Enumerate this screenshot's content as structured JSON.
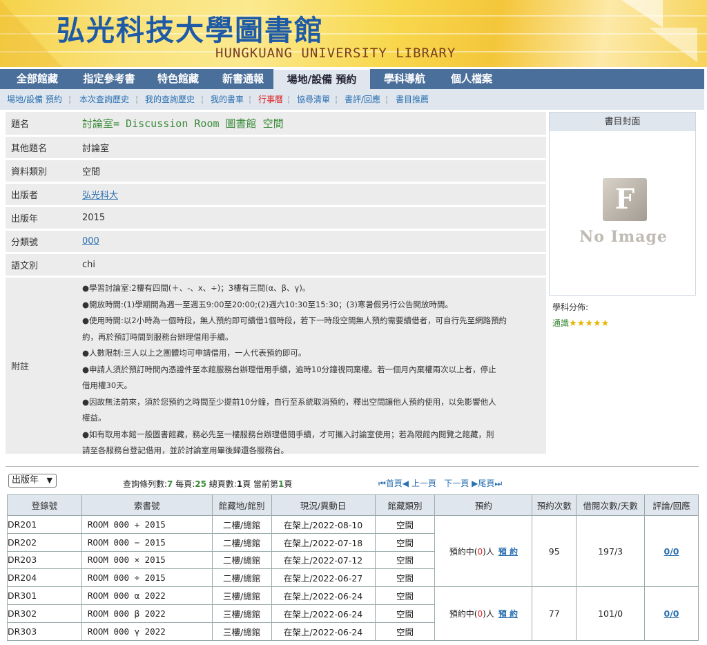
{
  "banner": {
    "title": "弘光科技大學圖書館",
    "subtitle": "HUNGKUANG UNIVERSITY LIBRARY"
  },
  "main_nav": {
    "tabs": [
      "全部館藏",
      "指定參考書",
      "特色館藏",
      "新書通報",
      "場地/設備 預約",
      "學科導航",
      "個人檔案"
    ],
    "active": "場地/設備 預約"
  },
  "sub_nav": {
    "items": [
      "場地/設備 預約",
      "本次查詢歷史",
      "我的查詢歷史",
      "我的書車",
      "行事曆",
      "協尋清單",
      "書評/回應",
      "書目推薦"
    ]
  },
  "record": {
    "title_label": "題名",
    "title_value": "討論室= Discussion Room 圖書館 空間",
    "other_title_label": "其他題名",
    "other_title_value": "討論室",
    "type_label": "資料類別",
    "type_value": "空間",
    "publisher_label": "出版者",
    "publisher_value": "弘光科大",
    "year_label": "出版年",
    "year_value": "2015",
    "class_label": "分類號",
    "class_value": "000",
    "lang_label": "語文別",
    "lang_value": "chi",
    "notes_label": "附註",
    "notes_lines": [
      "●學習討論室:2樓有四間(＋、-、x、÷)；3樓有三間(α、β、γ)。",
      "●開放時間:(1)學期間為週一至週五9:00至20:00;(2)週六10:30至15:30；(3)寒暑假另行公告開放時間。",
      "●使用時間:以2小時為一個時段，無人預約即可續借1個時段，若下一時段空間無人預約需要續借者，可自行先至網路預約",
      "約，再於預訂時間到服務台辦理借用手續。",
      "●人數限制:三人以上之團體均可申請借用，一人代表預約即可。",
      "●申請人須於預訂時間內憑證件至本館服務台辦理借用手續，逾時10分鐘視同棄權。若一個月內棄權兩次以上者，停止",
      "借用權30天。",
      "●因故無法前來，須於您預約之時間至少提前10分鐘，自行至系統取消預約，釋出空間讓他人預約使用，以免影響他人",
      "權益。",
      "●如有取用本館一般圖書館藏，務必先至一樓服務台辦理借閱手續，才可攜入討論室使用；若為限館內閱覽之館藏，則",
      "請至各服務台登記借用，並於討論室用畢後歸還各服務台。"
    ]
  },
  "cover": {
    "header": "書目封面",
    "placeholder_letter": "F",
    "placeholder_text": "No Image"
  },
  "subject": {
    "label": "學科分佈:",
    "value": "通識",
    "stars": "★★★★★"
  },
  "query": {
    "sort_label": "出版年",
    "info_prefix": "查詢條列數:",
    "count": "7",
    "per_page_label": " 每頁:",
    "per_page": "25",
    "pages_label": " 總頁數:",
    "pages": "1",
    "current_label": "頁 當前第",
    "current": "1",
    "page_suffix": "頁",
    "pager_first": "⏮首頁◀ 上一頁",
    "pager_next": "下一頁 ▶尾頁⏭"
  },
  "holdings": {
    "headers": [
      "登錄號",
      "索書號",
      "館藏地/館別",
      "現況/異動日",
      "館藏類別",
      "預約",
      "預約次數",
      "借閱次數/天數",
      "評論/回應"
    ],
    "rows": [
      [
        "DR201",
        "ROOM 000 + 2015",
        "二樓/總館",
        "在架上/2022-08-10",
        "空間"
      ],
      [
        "DR202",
        "ROOM 000 − 2015",
        "二樓/總館",
        "在架上/2022-07-18",
        "空間"
      ],
      [
        "DR203",
        "ROOM 000 × 2015",
        "二樓/總館",
        "在架上/2022-07-12",
        "空間"
      ],
      [
        "DR204",
        "ROOM 000 ÷ 2015",
        "二樓/總館",
        "在架上/2022-06-27",
        "空間"
      ],
      [
        "DR301",
        "ROOM 000 α 2022",
        "三樓/總館",
        "在架上/2022-06-24",
        "空間"
      ],
      [
        "DR302",
        "ROOM 000 β 2022",
        "三樓/總館",
        "在架上/2022-06-24",
        "空間"
      ],
      [
        "DR303",
        "ROOM 000 γ 2022",
        "三樓/總館",
        "在架上/2022-06-24",
        "空間"
      ]
    ],
    "groups": [
      {
        "reserve_prefix": "預約中(",
        "reserve_count": "0",
        "reserve_suffix": ")人",
        "reserve_link": "預 約",
        "reservations": "95",
        "loans": "197/3",
        "reviews": "0/0"
      },
      {
        "reserve_prefix": "預約中(",
        "reserve_count": "0",
        "reserve_suffix": ")人",
        "reserve_link": "預 約",
        "reservations": "77",
        "loans": "101/0",
        "reviews": "0/0"
      }
    ]
  },
  "colors": {
    "nav": "#4b6f9b",
    "subnav": "#dfe6ee",
    "link": "#2a6fb0",
    "accent_green": "#3a8a3a"
  }
}
